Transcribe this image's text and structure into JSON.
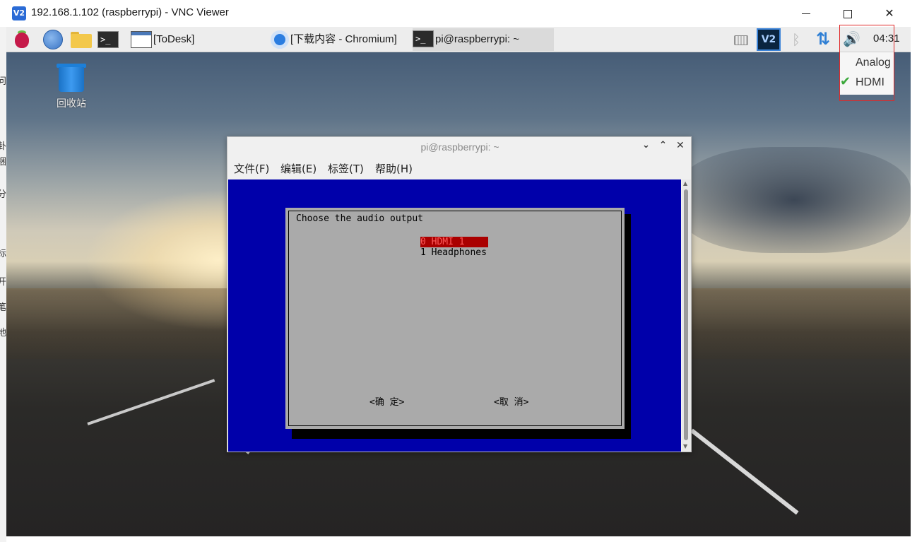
{
  "vnc_window": {
    "title": "192.168.1.102 (raspberrypi) - VNC Viewer",
    "logo_text": "V2",
    "minimize": "",
    "maximize": "",
    "close": "✕"
  },
  "left_sliver": {
    "chars": [
      "问",
      "卦",
      "捆",
      "分",
      "标",
      "开",
      "笔",
      "地"
    ]
  },
  "taskbar": {
    "todesk_label": "[ToDesk]",
    "chromium_label": "[下载内容 - Chromium]",
    "terminal_label": "pi@raspberrypi: ~",
    "term_glyph": ">_",
    "vnc_icon_text": "V2",
    "clock": "04:31"
  },
  "audio_menu": {
    "options": [
      "Analog",
      "HDMI"
    ],
    "selected": "HDMI"
  },
  "desktop": {
    "trash_label": "回收站"
  },
  "terminal": {
    "title": "pi@raspberrypi: ~",
    "menus": [
      "文件(F)",
      "编辑(E)",
      "标签(T)",
      "帮助(H)"
    ],
    "dialog": {
      "title": "Choose the audio output",
      "options": [
        "0 HDMI 1",
        "1 Headphones"
      ],
      "selected_index": 0,
      "ok_button": "<确 定>",
      "cancel_button": "<取 消>"
    }
  },
  "colors": {
    "terminal_bg": "#0000aa",
    "dialog_bg": "#aaaaaa",
    "selection_bg": "#aa0000",
    "highlight_box": "#e02828",
    "accent": "#3a8fe0"
  }
}
